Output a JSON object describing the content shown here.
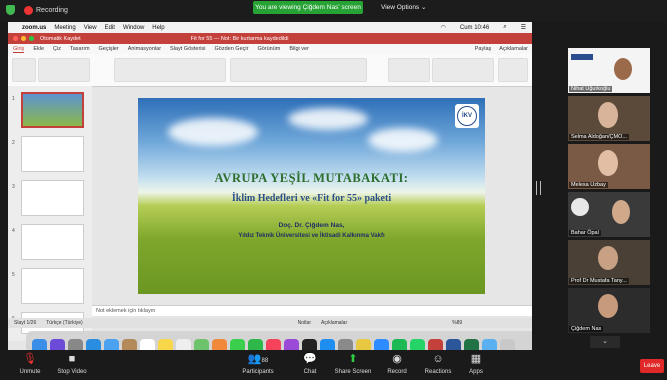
{
  "topbar": {
    "recording_label": "Recording",
    "viewing_banner": "You are viewing Çiğdem Nas' screen",
    "view_options": "View Options ⌄"
  },
  "mac_menu": [
    "zoom.us",
    "Meeting",
    "View",
    "Edit",
    "Window",
    "Help"
  ],
  "mac_clock": "Cum 10:46",
  "ppt": {
    "window_title": "Fit for 55 — Not: Bir kurtarma kaydedildi",
    "left_label": "Otomatik Kaydet",
    "tabs": [
      "Giriş",
      "Ekle",
      "Çiz",
      "Tasarım",
      "Geçişler",
      "Animasyonlar",
      "Slayt Gösterisi",
      "Gözden Geçir",
      "Görünüm",
      "Bilgi ver"
    ],
    "tabs_right": [
      "Paylaş",
      "Açıklamalar"
    ],
    "slide_numbers": [
      "1",
      "2",
      "3",
      "4",
      "5",
      "6"
    ],
    "notes_placeholder": "Not eklemek için tıklayın",
    "status_left": "Slayt 1/26",
    "status_lang": "Türkçe (Türkiye)",
    "status_notes": "Notlar",
    "status_comments": "Açıklamalar",
    "zoom": "%89"
  },
  "slide": {
    "title": "AVRUPA YEŞİL MUTABAKATI:",
    "subtitle": "İklim Hedefleri ve «Fit for 55» paketi",
    "author": "Doç. Dr. Çiğdem Nas,",
    "institution": "Yıldız Teknik Üniversitesi ve İktisadi Kalkınma Vakfı",
    "logo_text": "İKV"
  },
  "participants": [
    {
      "name": "Nihat Uğurkoğlu",
      "bg": "#f4f4f4"
    },
    {
      "name": "Selma Aldoğan/ÇMO...",
      "bg": "#5b4a3a"
    },
    {
      "name": "Melesa Uzbay",
      "bg": "#7a5a44"
    },
    {
      "name": "Bahar Öpal",
      "bg": "#3a3a3a"
    },
    {
      "name": "Prof Dr Mustafa Tany...",
      "bg": "#4a4036"
    },
    {
      "name": "Çiğdem Nas",
      "bg": "#2c2c2c"
    }
  ],
  "toolbar": {
    "unmute": "Unmute",
    "stop_video": "Stop Video",
    "participants": "Participants",
    "participants_count": "88",
    "chat": "Chat",
    "share_screen": "Share Screen",
    "record": "Record",
    "reactions": "Reactions",
    "apps": "Apps",
    "leave": "Leave"
  },
  "colors": {
    "ppt_red": "#c4403a",
    "zoom_green": "#26a334",
    "share_green": "#2ecc40",
    "leave_red": "#e02828"
  }
}
